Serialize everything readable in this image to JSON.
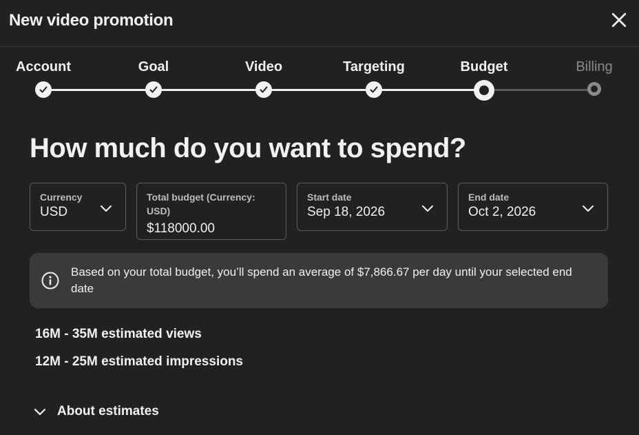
{
  "dialog": {
    "title": "New video promotion",
    "close_icon": "close-icon"
  },
  "stepper": {
    "steps": [
      {
        "label": "Account",
        "state": "completed"
      },
      {
        "label": "Goal",
        "state": "completed"
      },
      {
        "label": "Video",
        "state": "completed"
      },
      {
        "label": "Targeting",
        "state": "completed"
      },
      {
        "label": "Budget",
        "state": "current"
      },
      {
        "label": "Billing",
        "state": "upcoming"
      }
    ]
  },
  "main": {
    "heading": "How much do you want to spend?",
    "fields": {
      "currency": {
        "label": "Currency",
        "value": "USD"
      },
      "total_budget": {
        "label": "Total budget (Currency: USD)",
        "value": "$118000.00"
      },
      "start_date": {
        "label": "Start date",
        "value": "Sep 18, 2026"
      },
      "end_date": {
        "label": "End date",
        "value": "Oct 2, 2026"
      }
    },
    "info": {
      "icon": "info-icon",
      "text": "Based on your total budget, you’ll spend an average of $7,866.67 per day until your selected end date"
    },
    "estimates": {
      "views": "16M - 35M estimated views",
      "impressions": "12M - 25M estimated impressions"
    },
    "about_estimates": {
      "label": "About estimates",
      "icon": "chevron-down-icon"
    }
  },
  "colors": {
    "background": "#212121",
    "text": "#f1f1f1",
    "inactive": "#8a8a8a",
    "info_box": "#3a3a3a"
  }
}
